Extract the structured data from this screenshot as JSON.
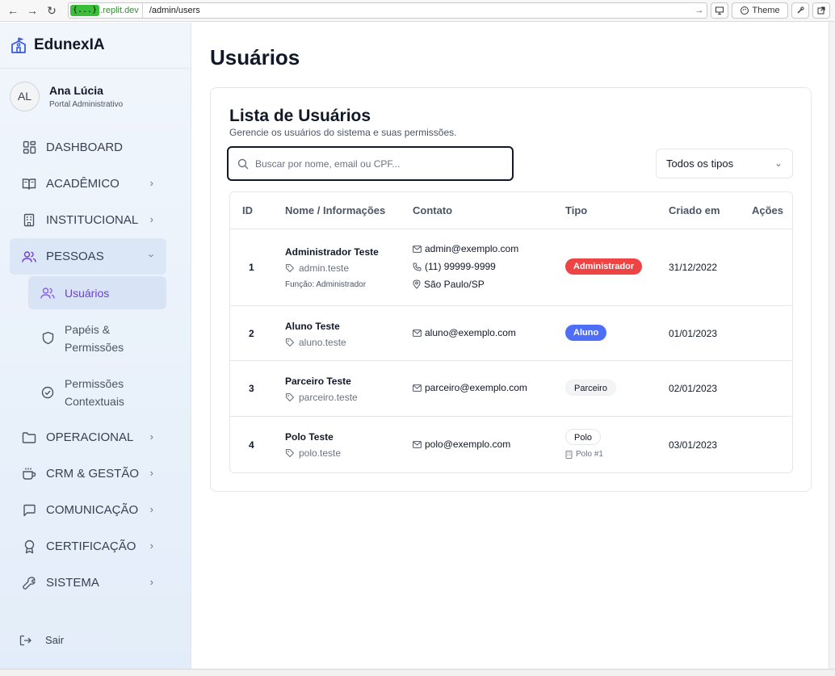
{
  "browser": {
    "url_host_badge": "{...}",
    "url_host": ".replit.dev",
    "url_path": "/admin/users",
    "theme_label": "Theme"
  },
  "brand": {
    "name": "EdunexIA"
  },
  "user": {
    "initials": "AL",
    "name": "Ana Lúcia",
    "role": "Portal Administrativo"
  },
  "sidebar": {
    "items": [
      {
        "label": "DASHBOARD",
        "icon": "dashboard-icon"
      },
      {
        "label": "ACADÊMICO",
        "icon": "book-icon"
      },
      {
        "label": "INSTITUCIONAL",
        "icon": "building-icon"
      },
      {
        "label": "PESSOAS",
        "icon": "users-icon"
      },
      {
        "label": "OPERACIONAL",
        "icon": "folder-icon"
      },
      {
        "label": "CRM & GESTÃO",
        "icon": "coffee-icon"
      },
      {
        "label": "COMUNICAÇÃO",
        "icon": "message-icon"
      },
      {
        "label": "CERTIFICAÇÃO",
        "icon": "award-icon"
      },
      {
        "label": "SISTEMA",
        "icon": "wrench-icon"
      }
    ],
    "sub_items": [
      {
        "label": "Usuários",
        "icon": "users-icon"
      },
      {
        "label_1": "Papéis &",
        "label_2": "Permissões",
        "icon": "shield-icon"
      },
      {
        "label_1": "Permissões",
        "label_2": "Contextuais",
        "icon": "check-circle-icon"
      }
    ],
    "logout_label": "Sair"
  },
  "page": {
    "title": "Usuários"
  },
  "card": {
    "title": "Lista de Usuários",
    "subtitle": "Gerencie os usuários do sistema e suas permissões.",
    "search_placeholder": "Buscar por nome, email ou CPF...",
    "filter_value": "Todos os tipos"
  },
  "table": {
    "headers": [
      "ID",
      "Nome / Informações",
      "Contato",
      "Tipo",
      "Criado em",
      "Ações"
    ],
    "rows": [
      {
        "id": "1",
        "name": "Administrador Teste",
        "login": "admin.teste",
        "function": "Função: Administrador",
        "email": "admin@exemplo.com",
        "phone": "(11) 99999-9999",
        "location": "São Paulo/SP",
        "type": "Administrador",
        "created": "31/12/2022"
      },
      {
        "id": "2",
        "name": "Aluno Teste",
        "login": "aluno.teste",
        "email": "aluno@exemplo.com",
        "type": "Aluno",
        "created": "01/01/2023"
      },
      {
        "id": "3",
        "name": "Parceiro Teste",
        "login": "parceiro.teste",
        "email": "parceiro@exemplo.com",
        "type": "Parceiro",
        "created": "02/01/2023"
      },
      {
        "id": "4",
        "name": "Polo Teste",
        "login": "polo.teste",
        "email": "polo@exemplo.com",
        "type": "Polo",
        "type_sub": "Polo #1",
        "created": "03/01/2023"
      }
    ]
  },
  "colors": {
    "admin_badge": "#ef4444",
    "aluno_badge": "#4f6ef7",
    "active_sub": "#6d3fd4"
  }
}
